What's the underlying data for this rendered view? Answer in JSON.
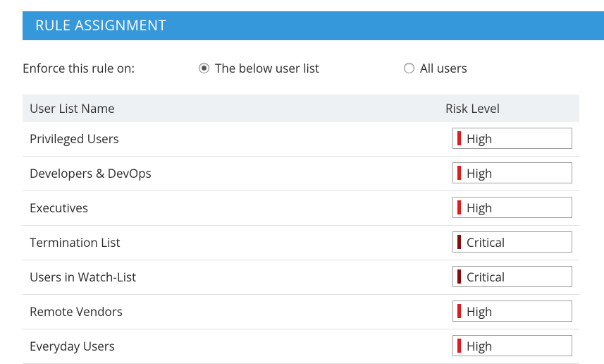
{
  "header": {
    "title": "RULE ASSIGNMENT"
  },
  "enforce": {
    "label": "Enforce this rule on:",
    "options": [
      {
        "label": "The below user list",
        "selected": true
      },
      {
        "label": "All users",
        "selected": false
      }
    ]
  },
  "table": {
    "columns": {
      "name": "User List Name",
      "risk": "Risk Level"
    },
    "rows": [
      {
        "name": "Privileged Users",
        "risk": "High",
        "risk_color": "#e01b1b"
      },
      {
        "name": "Developers & DevOps",
        "risk": "High",
        "risk_color": "#e01b1b"
      },
      {
        "name": "Executives",
        "risk": "High",
        "risk_color": "#e01b1b"
      },
      {
        "name": "Termination List",
        "risk": "Critical",
        "risk_color": "#8a0a0a"
      },
      {
        "name": "Users in Watch-List",
        "risk": "Critical",
        "risk_color": "#8a0a0a"
      },
      {
        "name": "Remote Vendors",
        "risk": "High",
        "risk_color": "#e01b1b"
      },
      {
        "name": "Everyday Users",
        "risk": "High",
        "risk_color": "#e01b1b"
      }
    ]
  }
}
